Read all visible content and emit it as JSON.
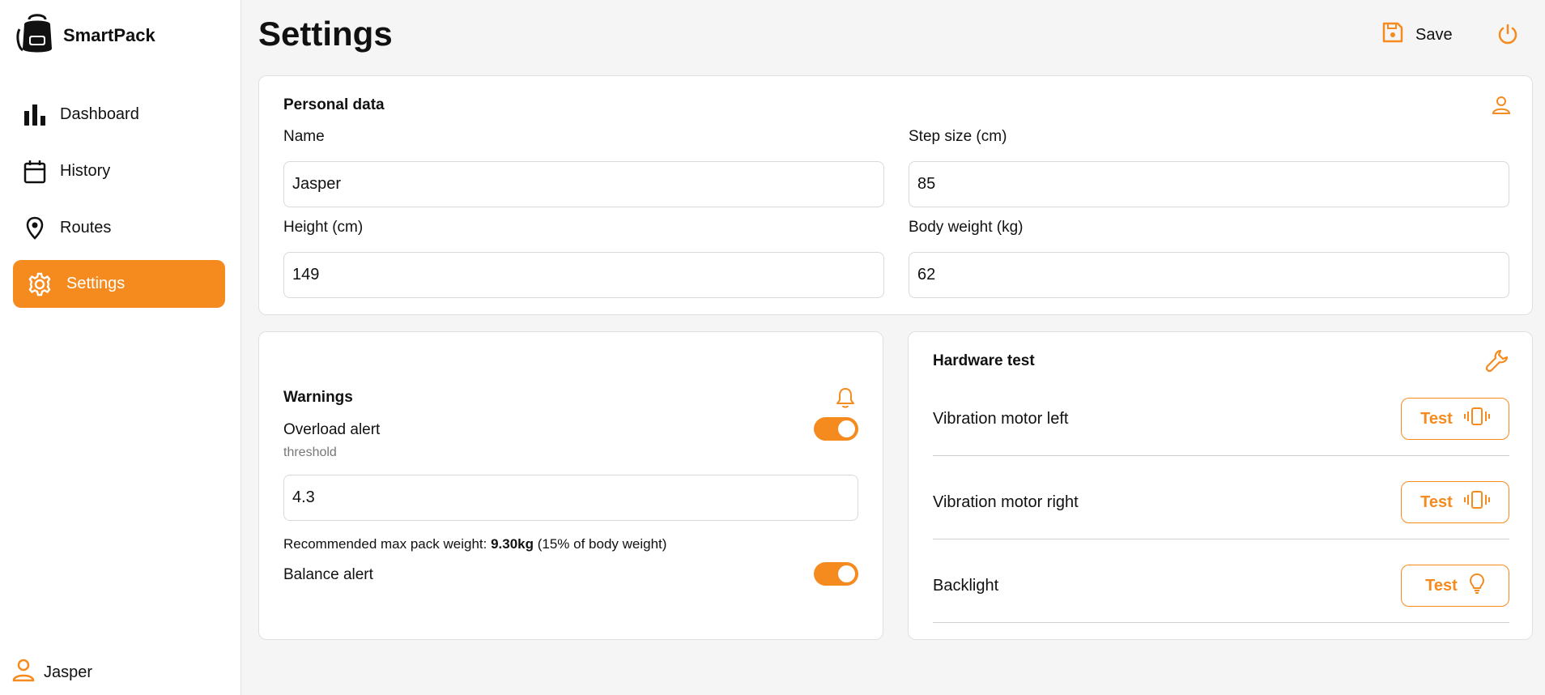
{
  "app": {
    "name": "SmartPack"
  },
  "sidebar": {
    "items": [
      {
        "label": "Dashboard",
        "icon": "bar-chart-icon",
        "active": false
      },
      {
        "label": "History",
        "icon": "calendar-icon",
        "active": false
      },
      {
        "label": "Routes",
        "icon": "map-pin-icon",
        "active": false
      },
      {
        "label": "Settings",
        "icon": "gear-icon",
        "active": true
      }
    ],
    "user": {
      "name": "Jasper"
    }
  },
  "header": {
    "title": "Settings",
    "save_label": "Save"
  },
  "personal": {
    "title": "Personal data",
    "name_label": "Name",
    "name_value": "Jasper",
    "step_label": "Step size (cm)",
    "step_value": "85",
    "height_label": "Height (cm)",
    "height_value": "149",
    "weight_label": "Body weight (kg)",
    "weight_value": "62"
  },
  "warnings": {
    "title": "Warnings",
    "overload_label": "Overload alert",
    "overload_on": true,
    "threshold_label": "threshold",
    "threshold_value": "4.3",
    "rec_prefix": "Recommended max pack weight: ",
    "rec_value": "9.30kg",
    "rec_suffix": " (15% of body weight)",
    "balance_label": "Balance alert",
    "balance_on": true
  },
  "hardware": {
    "title": "Hardware test",
    "rows": [
      {
        "label": "Vibration motor left",
        "button": "Test",
        "icon": "vibrate-icon"
      },
      {
        "label": "Vibration motor right",
        "button": "Test",
        "icon": "vibrate-icon"
      },
      {
        "label": "Backlight",
        "button": "Test",
        "icon": "lightbulb-icon"
      }
    ]
  },
  "colors": {
    "accent": "#f58b1f",
    "background": "#f5f5f5",
    "card": "#ffffff"
  }
}
